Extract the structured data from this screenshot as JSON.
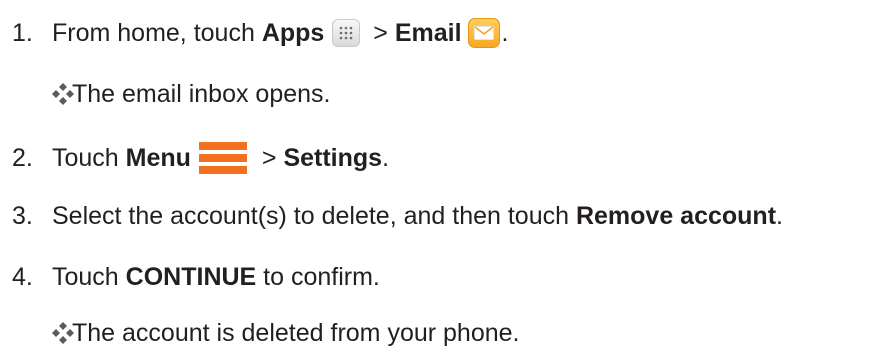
{
  "steps": [
    {
      "number": "1.",
      "text_a": "From home, touch ",
      "bold_a": "Apps",
      "sep": " > ",
      "bold_b": "Email",
      "end": "."
    },
    {
      "number": "2.",
      "text_a": "Touch ",
      "bold_a": "Menu",
      "sep": " > ",
      "bold_b": "Settings",
      "end": "."
    },
    {
      "number": "3.",
      "text_a": "Select the account(s) to delete, and then touch ",
      "bold_a": "Remove account",
      "end": "."
    },
    {
      "number": "4.",
      "text_a": "Touch ",
      "bold_a": "CONTINUE",
      "text_b": " to confirm."
    }
  ],
  "results": [
    "The email inbox opens.",
    "The account is deleted from your phone."
  ],
  "icons": {
    "apps": "apps-grid-icon",
    "email": "email-envelope-icon",
    "menu": "menu-hamburger-icon",
    "bullet": "diamond-bullet-icon"
  },
  "colors": {
    "text": "#231f20",
    "menu_icon": "#f37021",
    "email_icon": "#f5a623"
  }
}
